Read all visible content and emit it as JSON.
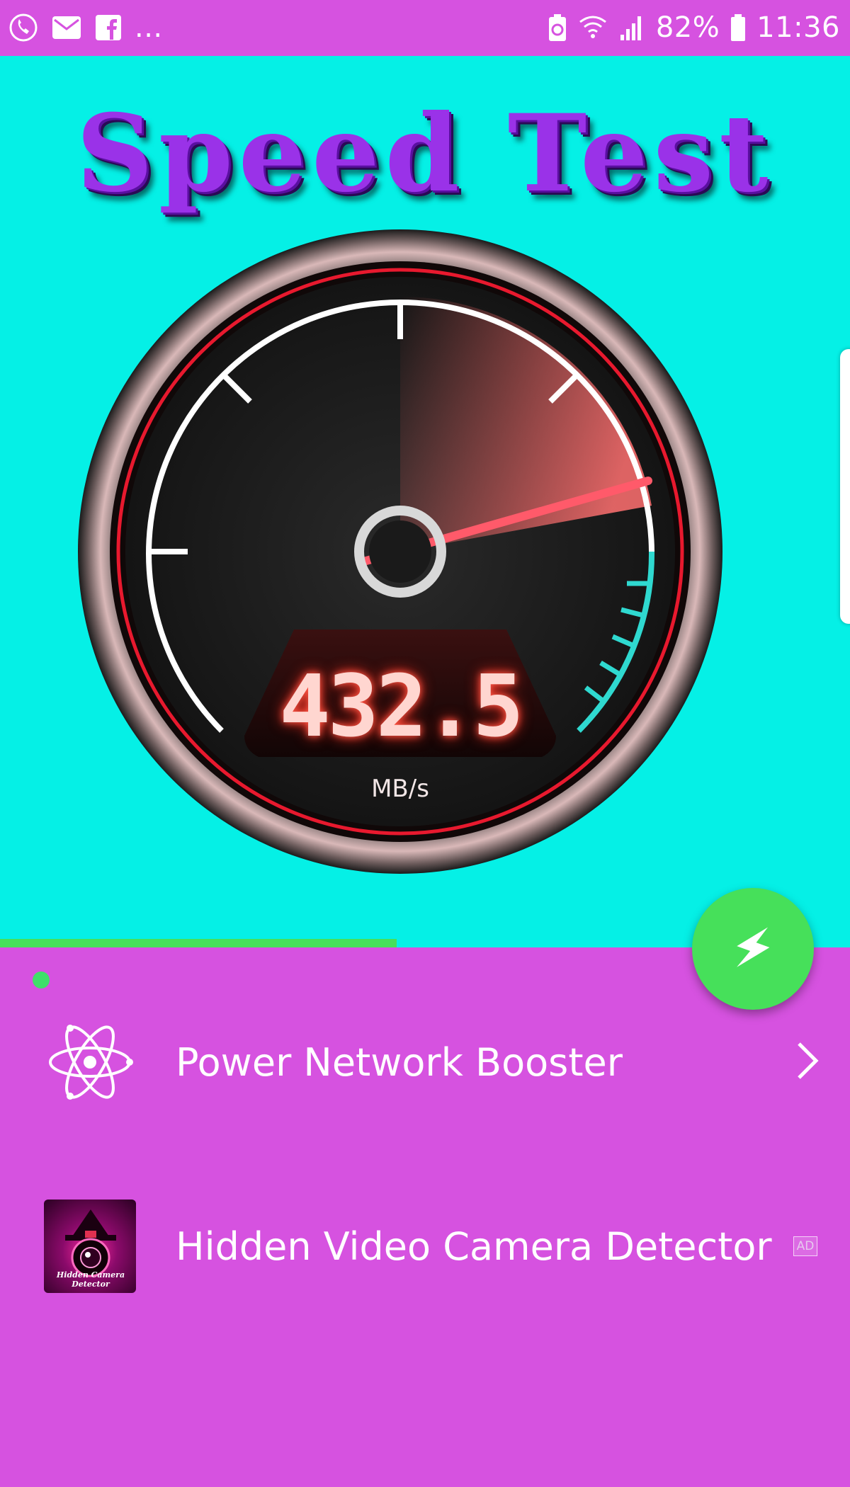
{
  "status_bar": {
    "left_icons": [
      "phone-call-icon",
      "mail-icon",
      "facebook-icon"
    ],
    "more_indicator": "...",
    "right_icons": [
      "battery-saver-icon",
      "wifi-icon",
      "signal-icon"
    ],
    "battery_percent": "82%",
    "time": "11:36"
  },
  "hero": {
    "title": "Speed Test",
    "background_color": "#05f0e6",
    "gauge": {
      "value": "432.5",
      "unit": "MB/s",
      "needle_level_fraction": 0.78
    },
    "progress_fraction": 0.467
  },
  "fab": {
    "icon": "lightning-bolt-icon",
    "color": "#46e05a"
  },
  "list": {
    "items": [
      {
        "label": "Power Network Booster",
        "icon": "atom-icon",
        "trailing": "chevron-right-icon"
      },
      {
        "label": "Hidden Video Camera Detector",
        "icon": "hidden-camera-detector-app-icon",
        "thumb_caption": "Hidden Camera Detector",
        "badge": "AD"
      }
    ]
  },
  "colors": {
    "accent_magenta": "#d652e0",
    "accent_green": "#46e05a",
    "gauge_teal": "#2fd9d0",
    "gauge_red": "#ff3040"
  }
}
